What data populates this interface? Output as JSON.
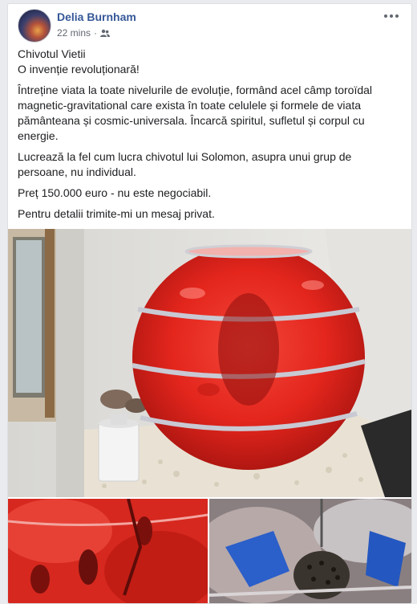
{
  "post": {
    "author": "Delia Burnham",
    "time": "22 mins",
    "separator": "·",
    "audience_icon": "friends-icon",
    "menu_icon": "more-options-icon",
    "paragraphs": [
      "Chivotul Vietii",
      "O invenție revoluționară!",
      "Întreține viata la toate nivelurile de evoluție, formând acel câmp toroïdal magnetic-gravitational care exista în toate celulele și formele de viata pământeana și cosmic-universala. Încarcă spiritul, sufletul și corpul cu energie.",
      "Lucrează la fel cum lucra chivotul lui Solomon, asupra unui grup de persoane, nu individual.",
      "Preț 150.000 euro - nu este negociabil.",
      "Pentru detalii trimite-mi un mesaj privat."
    ]
  },
  "colors": {
    "author_link": "#365899",
    "meta_text": "#616770",
    "orb_red": "#e8241c"
  }
}
